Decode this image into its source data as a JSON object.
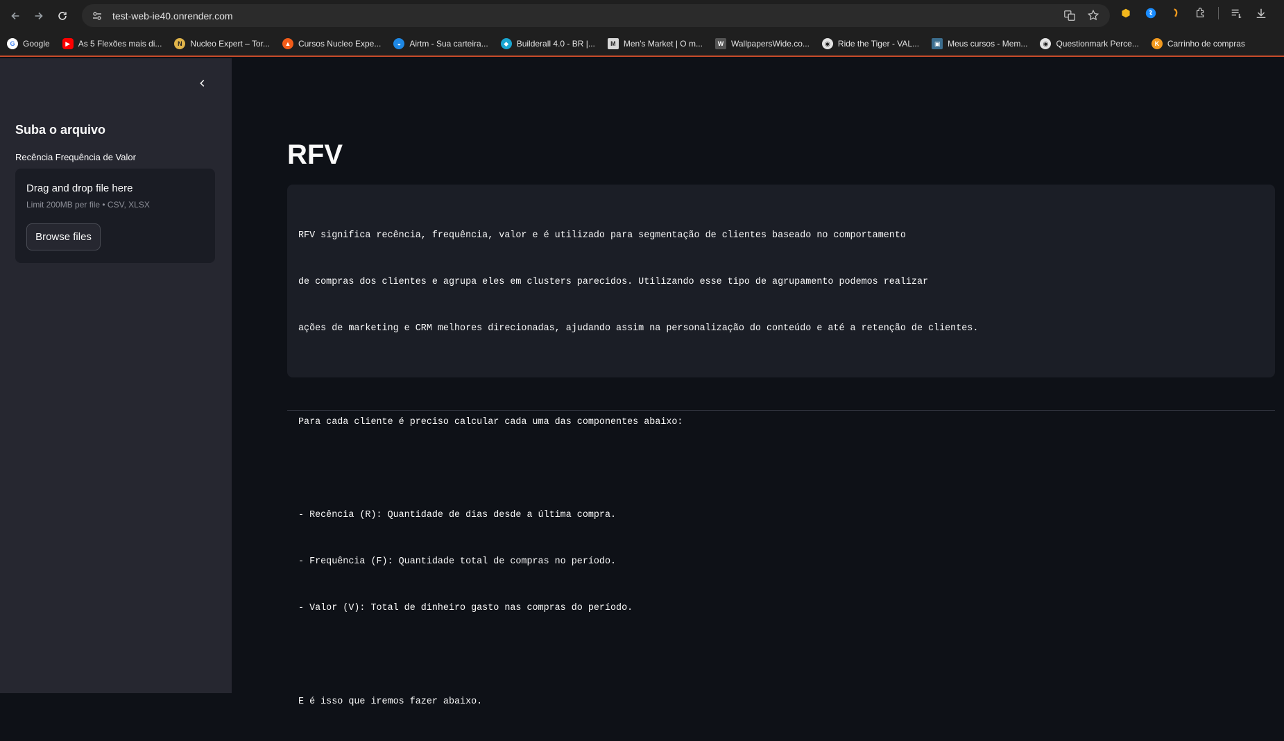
{
  "browser": {
    "url": "test-web-ie40.onrender.com",
    "bookmarks": [
      {
        "label": "Google",
        "icon": "google-icon",
        "color": "#4285f4"
      },
      {
        "label": "As 5 Flexões mais di...",
        "icon": "youtube-icon",
        "color": "#ff0000"
      },
      {
        "label": "Nucleo Expert – Tor...",
        "icon": "nucleo-icon",
        "color": "#e0b44a"
      },
      {
        "label": "Cursos Nucleo Expe...",
        "icon": "flame-icon",
        "color": "#f25c19"
      },
      {
        "label": "Airtm - Sua carteira...",
        "icon": "airtm-icon",
        "color": "#1e88e5"
      },
      {
        "label": "Builderall 4.0 - BR |...",
        "icon": "builderall-icon",
        "color": "#1aa6d1"
      },
      {
        "label": "Men's Market | O m...",
        "icon": "mensmarket-icon",
        "color": "#d8d8d8"
      },
      {
        "label": "WallpapersWide.co...",
        "icon": "wallpaperswide-icon",
        "color": "#555555"
      },
      {
        "label": "Ride the Tiger - VAL...",
        "icon": "globe-icon",
        "color": "#e3e3e3"
      },
      {
        "label": "Meus cursos - Mem...",
        "icon": "course-icon",
        "color": "#3c6e8f"
      },
      {
        "label": "Questionmark Perce...",
        "icon": "globe-icon",
        "color": "#e3e3e3"
      },
      {
        "label": "Carrinho de compras",
        "icon": "k-icon",
        "color": "#f29a1f"
      }
    ]
  },
  "sidebar": {
    "title": "Suba o arquivo",
    "uploader_label": "Recência Frequência de Valor",
    "dropzone_title": "Drag and drop file here",
    "dropzone_limit": "Limit 200MB per file • CSV, XLSX",
    "browse_label": "Browse files"
  },
  "main": {
    "title": "RFV",
    "code_lines": [
      "RFV significa recência, frequência, valor e é utilizado para segmentação de clientes baseado no comportamento",
      "de compras dos clientes e agrupa eles em clusters parecidos. Utilizando esse tipo de agrupamento podemos realizar",
      "ações de marketing e CRM melhores direcionadas, ajudando assim na personalização do conteúdo e até a retenção de clientes.",
      "",
      "Para cada cliente é preciso calcular cada uma das componentes abaixo:",
      "",
      "- Recência (R): Quantidade de dias desde a última compra.",
      "- Frequência (F): Quantidade total de compras no período.",
      "- Valor (V): Total de dinheiro gasto nas compras do período.",
      "",
      "E é isso que iremos fazer abaixo."
    ]
  },
  "colors": {
    "app_bg": "#0e1117",
    "sidebar_bg": "#262730",
    "code_bg": "#1b1e26",
    "accent_line": "#c74b2a"
  }
}
